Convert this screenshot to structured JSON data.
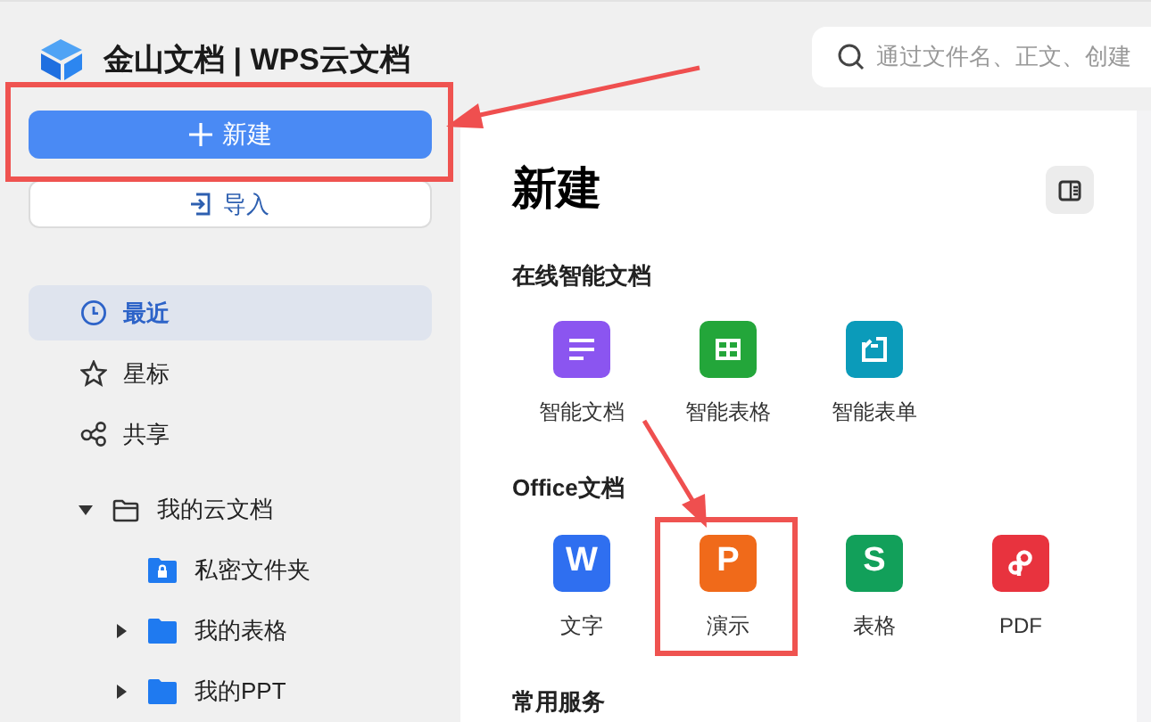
{
  "header": {
    "logo_text": "金山文档 | WPS云文档",
    "search": {
      "placeholder": "通过文件名、正文、创建"
    }
  },
  "sidebar": {
    "new_button": {
      "label": "新建",
      "highlighted": true
    },
    "import_button": {
      "label": "导入"
    },
    "nav": [
      {
        "label": "最近",
        "selected": true
      },
      {
        "label": "星标",
        "selected": false
      },
      {
        "label": "共享",
        "selected": false
      }
    ],
    "tree": [
      {
        "label": "我的云文档",
        "expanded": true,
        "kind": "root",
        "children": [
          {
            "label": "私密文件夹",
            "kind": "locked"
          },
          {
            "label": "我的表格",
            "kind": "folder",
            "expanded": false
          },
          {
            "label": "我的PPT",
            "kind": "folder",
            "expanded": false
          }
        ]
      }
    ]
  },
  "main": {
    "title": "新建",
    "sections": [
      {
        "title": "在线智能文档",
        "items": [
          {
            "label": "智能文档",
            "kind": "lines",
            "color": "#8b55f0",
            "highlighted": false
          },
          {
            "label": "智能表格",
            "kind": "grid",
            "color": "#23a63a",
            "highlighted": false
          },
          {
            "label": "智能表单",
            "kind": "form",
            "color": "#0b9bba",
            "highlighted": false
          }
        ]
      },
      {
        "title": "Office文档",
        "items": [
          {
            "label": "文字",
            "kind": "letter",
            "glyph": "W",
            "color": "#2f6ff0",
            "highlighted": false
          },
          {
            "label": "演示",
            "kind": "letter",
            "glyph": "P",
            "color": "#f06a1a",
            "highlighted": true
          },
          {
            "label": "表格",
            "kind": "letter",
            "glyph": "S",
            "color": "#12a05a",
            "highlighted": false
          },
          {
            "label": "PDF",
            "kind": "pdf",
            "color": "#e8333e",
            "highlighted": false
          }
        ]
      },
      {
        "title": "常用服务"
      }
    ]
  }
}
